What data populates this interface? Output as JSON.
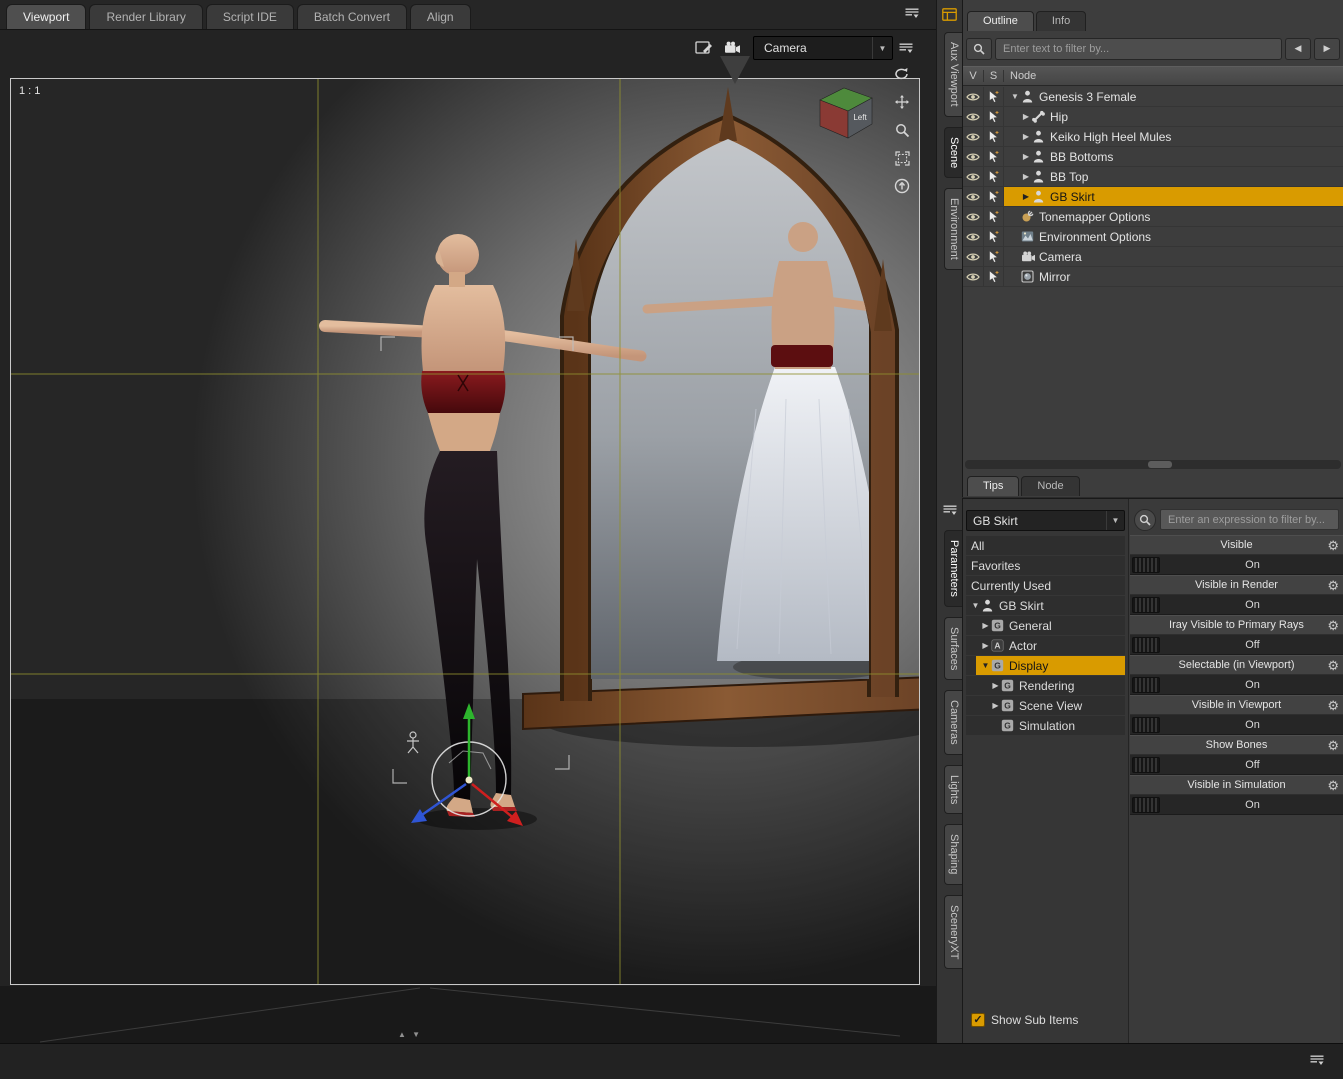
{
  "colors": {
    "accent": "#d99b00",
    "panel_bg": "#3d3d3d",
    "guide_yellow": "#8f8f2e",
    "selection_text": "#141414"
  },
  "top_tabs": [
    {
      "label": "Viewport",
      "active": true
    },
    {
      "label": "Render Library",
      "active": false
    },
    {
      "label": "Script IDE",
      "active": false
    },
    {
      "label": "Batch Convert",
      "active": false
    },
    {
      "label": "Align",
      "active": false
    }
  ],
  "viewport": {
    "ratio_label": "1 : 1",
    "camera_selected": "Camera",
    "cube_label": "Left"
  },
  "side_tabs_top": [
    {
      "label": "Aux Viewport",
      "active": false
    },
    {
      "label": "Scene",
      "active": true
    },
    {
      "label": "Environment",
      "active": false
    }
  ],
  "side_tabs_bottom": [
    {
      "label": "Parameters",
      "active": true
    },
    {
      "label": "Surfaces",
      "active": false
    },
    {
      "label": "Cameras",
      "active": false
    },
    {
      "label": "Lights",
      "active": false
    },
    {
      "label": "Shaping",
      "active": false
    },
    {
      "label": "SceneryXT",
      "active": false
    }
  ],
  "outline": {
    "tabs": [
      "Outline",
      "Info"
    ],
    "filter_placeholder": "Enter text to filter by...",
    "columns": [
      "V",
      "S",
      "Node"
    ],
    "rows": [
      {
        "label": "Genesis 3 Female",
        "icon": "figure",
        "expander": "down",
        "indent": 0,
        "selected": false
      },
      {
        "label": "Hip",
        "icon": "bone",
        "expander": "right",
        "indent": 1,
        "selected": false
      },
      {
        "label": "Keiko High Heel Mules",
        "icon": "figure",
        "expander": "right",
        "indent": 1,
        "selected": false
      },
      {
        "label": "BB Bottoms",
        "icon": "figure",
        "expander": "right",
        "indent": 1,
        "selected": false
      },
      {
        "label": "BB Top",
        "icon": "figure",
        "expander": "right",
        "indent": 1,
        "selected": false
      },
      {
        "label": "GB Skirt",
        "icon": "figure",
        "expander": "right",
        "indent": 1,
        "selected": true
      },
      {
        "label": "Tonemapper Options",
        "icon": "tonemapper",
        "expander": "",
        "indent": 0,
        "selected": false
      },
      {
        "label": "Environment Options",
        "icon": "environment",
        "expander": "",
        "indent": 0,
        "selected": false
      },
      {
        "label": "Camera",
        "icon": "camera",
        "expander": "",
        "indent": 0,
        "selected": false
      },
      {
        "label": "Mirror",
        "icon": "mirror",
        "expander": "",
        "indent": 0,
        "selected": false
      }
    ],
    "bottom_tabs": [
      "Tips",
      "Node"
    ]
  },
  "params": {
    "scope_dropdown": "GB Skirt",
    "list_items": [
      "All",
      "Favorites",
      "Currently Used"
    ],
    "tree": [
      {
        "label": "GB Skirt",
        "icon": "figure",
        "expander": "down",
        "indent": 0,
        "selected": false
      },
      {
        "label": "General",
        "icon": "gbox",
        "expander": "right",
        "indent": 1,
        "selected": false
      },
      {
        "label": "Actor",
        "icon": "abox",
        "expander": "right",
        "indent": 1,
        "selected": false
      },
      {
        "label": "Display",
        "icon": "gbox",
        "expander": "down",
        "indent": 1,
        "selected": true
      },
      {
        "label": "Rendering",
        "icon": "gbox",
        "expander": "right",
        "indent": 2,
        "selected": false
      },
      {
        "label": "Scene View",
        "icon": "gbox",
        "expander": "right",
        "indent": 2,
        "selected": false
      },
      {
        "label": "Simulation",
        "icon": "gbox",
        "expander": "",
        "indent": 2,
        "selected": false
      }
    ],
    "show_sub_items_label": "Show Sub Items",
    "filter_placeholder": "Enter an expression to filter by...",
    "properties": [
      {
        "label": "Visible",
        "value": "On"
      },
      {
        "label": "Visible in Render",
        "value": "On"
      },
      {
        "label": "Iray Visible to Primary Rays",
        "value": "Off"
      },
      {
        "label": "Selectable (in Viewport)",
        "value": "On"
      },
      {
        "label": "Visible in Viewport",
        "value": "On"
      },
      {
        "label": "Show Bones",
        "value": "Off"
      },
      {
        "label": "Visible in Simulation",
        "value": "On"
      }
    ]
  },
  "icons_glyphs": {
    "expander_down": "▼",
    "expander_right": "▶",
    "dropdown_arrow": "▼",
    "gear": "⚙",
    "check": "✓",
    "prev_arrow": "◀",
    "next_arrow": "▶",
    "splitter": "▲ ▼"
  }
}
